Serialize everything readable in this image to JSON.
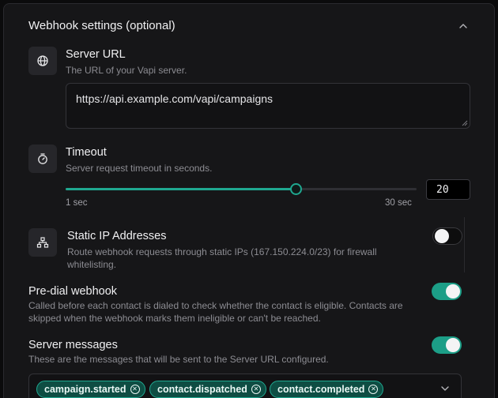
{
  "section": {
    "title": "Webhook settings (optional)"
  },
  "server_url": {
    "title": "Server URL",
    "description": "The URL of your Vapi server.",
    "value": "https://api.example.com/vapi/campaigns",
    "icon": "globe-icon"
  },
  "timeout": {
    "title": "Timeout",
    "description": "Server request timeout in seconds.",
    "min_label": "1 sec",
    "max_label": "30 sec",
    "min": 1,
    "max": 30,
    "value": 20,
    "value_text": "20",
    "icon": "timer-icon"
  },
  "static_ip": {
    "title": "Static IP Addresses",
    "description": "Route webhook requests through static IPs (167.150.224.0/23) for firewall whitelisting.",
    "enabled": false,
    "icon": "network-icon"
  },
  "pre_dial": {
    "title": "Pre-dial webhook",
    "description": "Called before each contact is dialed to check whether the contact is eligible. Contacts are skipped when the webhook marks them ineligible or can't be reached.",
    "enabled": true
  },
  "server_messages": {
    "title": "Server messages",
    "description": "These are the messages that will be sent to the Server URL configured.",
    "enabled": true,
    "selected": [
      "campaign.started",
      "contact.dispatched",
      "contact.completed"
    ]
  },
  "colors": {
    "accent": "#1fa890",
    "toggle_on": "#1c9e87",
    "chip_bg": "#0e4d43",
    "panel": "#161618"
  }
}
